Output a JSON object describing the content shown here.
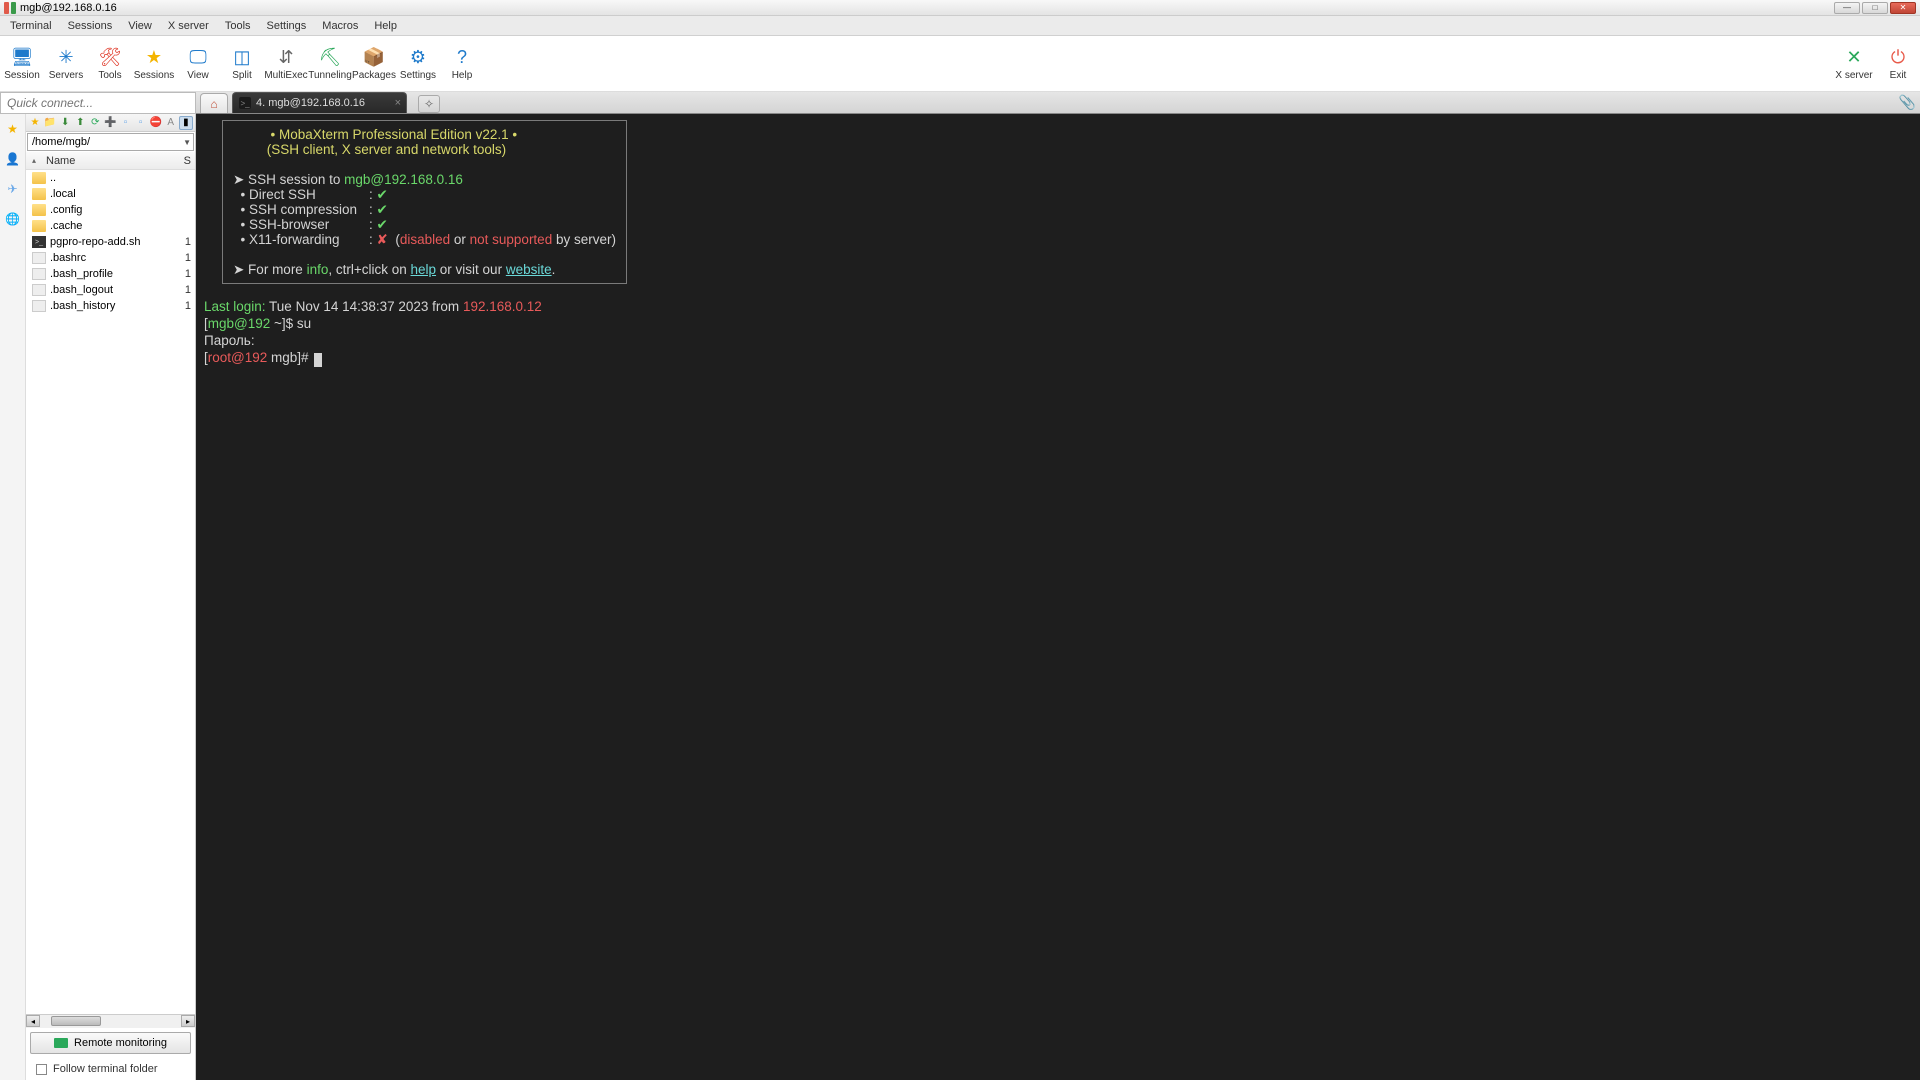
{
  "window_title": "mgb@192.168.0.16",
  "menu": [
    "Terminal",
    "Sessions",
    "View",
    "X server",
    "Tools",
    "Settings",
    "Macros",
    "Help"
  ],
  "toolbar": [
    {
      "k": "session",
      "label": "Session",
      "icon": "🖥",
      "cls": "c-blue"
    },
    {
      "k": "servers",
      "label": "Servers",
      "icon": "✳",
      "cls": "c-blue"
    },
    {
      "k": "tools",
      "label": "Tools",
      "icon": "🛠",
      "cls": "c-red"
    },
    {
      "k": "sessions",
      "label": "Sessions",
      "icon": "★",
      "cls": "c-yel"
    },
    {
      "k": "view",
      "label": "View",
      "icon": "🖵",
      "cls": "c-blue"
    },
    {
      "k": "split",
      "label": "Split",
      "icon": "◫",
      "cls": "c-blue"
    },
    {
      "k": "multiexec",
      "label": "MultiExec",
      "icon": "⇵",
      "cls": "c-gray"
    },
    {
      "k": "tunneling",
      "label": "Tunneling",
      "icon": "⛏",
      "cls": "c-grn"
    },
    {
      "k": "packages",
      "label": "Packages",
      "icon": "📦",
      "cls": "c-gray"
    },
    {
      "k": "settings",
      "label": "Settings",
      "icon": "⚙",
      "cls": "c-blue"
    },
    {
      "k": "help",
      "label": "Help",
      "icon": "?",
      "cls": "c-blue"
    }
  ],
  "toolbar_right": [
    {
      "k": "xserver",
      "label": "X server",
      "icon": "✕",
      "cls": "c-grn"
    },
    {
      "k": "exit",
      "label": "Exit",
      "icon": "⏻",
      "cls": "c-ored"
    }
  ],
  "quick_connect_placeholder": "Quick connect...",
  "tab": {
    "num": "4.",
    "title": "mgb@192.168.0.16"
  },
  "side_icons": [
    "★",
    "👤",
    "✈",
    "🌐"
  ],
  "path": "/home/mgb/",
  "name_hdr": "Name",
  "size_hdr": "S",
  "files": [
    {
      "n": "..",
      "t": "folder",
      "s": ""
    },
    {
      "n": ".local",
      "t": "folder",
      "s": ""
    },
    {
      "n": ".config",
      "t": "folder",
      "s": ""
    },
    {
      "n": ".cache",
      "t": "folder",
      "s": ""
    },
    {
      "n": "pgpro-repo-add.sh",
      "t": "sh",
      "s": "1"
    },
    {
      "n": ".bashrc",
      "t": "file",
      "s": "1"
    },
    {
      "n": ".bash_profile",
      "t": "file",
      "s": "1"
    },
    {
      "n": ".bash_logout",
      "t": "file",
      "s": "1"
    },
    {
      "n": ".bash_history",
      "t": "file",
      "s": "1"
    }
  ],
  "remote_monitoring": "Remote monitoring",
  "follow_label": "Follow terminal folder",
  "banner": {
    "l1": "• MobaXterm Professional Edition v22.1 •",
    "l2": "(SSH client, X server and network tools)"
  },
  "ssh": {
    "prefix": "➤ SSH session to ",
    "target": "mgb@192.168.0.16",
    "rows": [
      {
        "k": "Direct SSH",
        "v": "✔",
        "ok": true
      },
      {
        "k": "SSH compression",
        "v": "✔",
        "ok": true
      },
      {
        "k": "SSH-browser",
        "v": "✔",
        "ok": true
      }
    ],
    "x11_k": "X11-forwarding",
    "x11_v": "✘",
    "x11_open": "(",
    "x11_disabled": "disabled",
    "x11_or": " or ",
    "x11_not": "not supported",
    "x11_by": " by server)"
  },
  "more": {
    "a": "➤ For more ",
    "info": "info",
    "b": ", ctrl+click on ",
    "help": "help",
    "c": " or visit our ",
    "web": "website",
    "d": "."
  },
  "console": {
    "last_a": "Last login:",
    "last_b": " Tue Nov 14 14:38:37 2023 from ",
    "last_ip": "192.168.0.12",
    "p1_open": "[",
    "p1_user": "mgb@192",
    "p1_rest": " ~]$ ",
    "p1_cmd": "su",
    "pw": "Пароль:",
    "p2_open": "[",
    "p2_user": "root@192",
    "p2_rest": " mgb]# "
  }
}
